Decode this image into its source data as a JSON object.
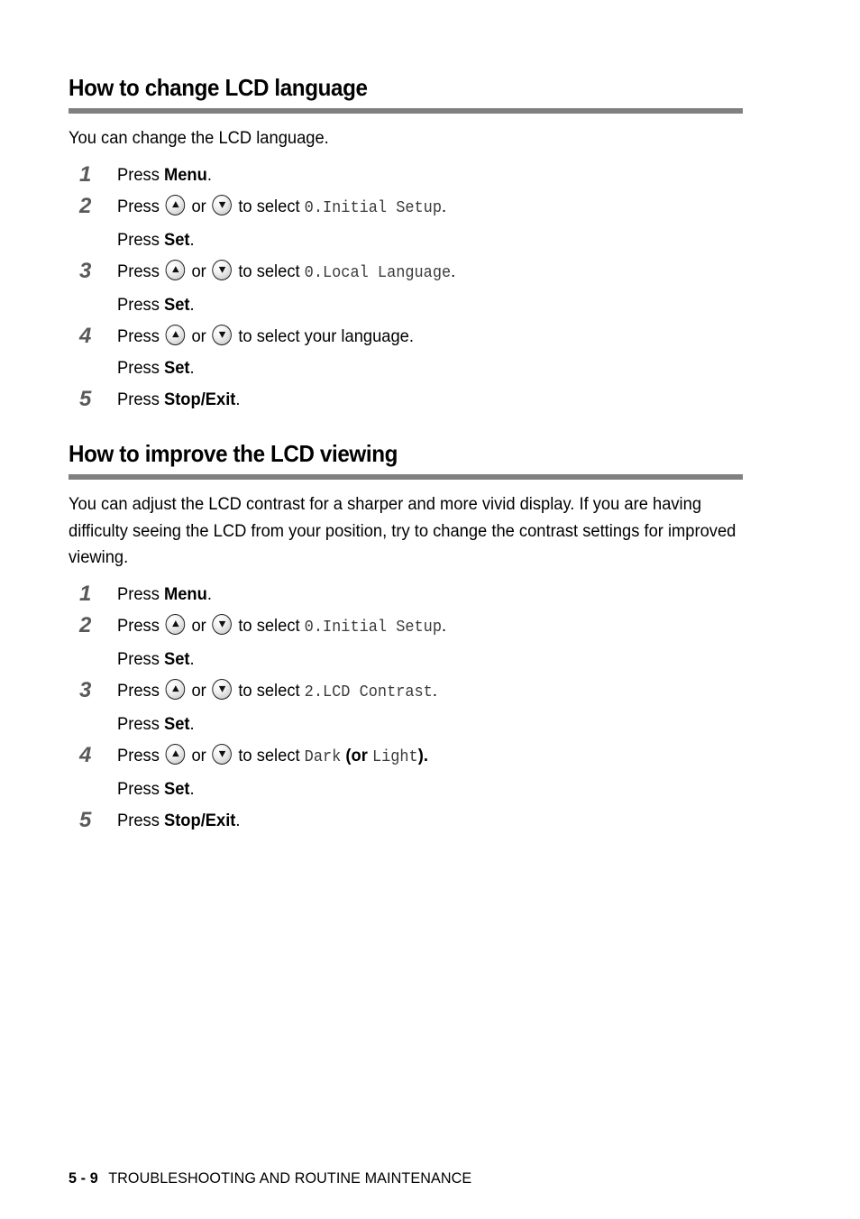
{
  "page": {
    "footer_page_number": "5 - 9",
    "footer_title": "TROUBLESHOOTING AND ROUTINE MAINTENANCE",
    "rule_color": "#808080",
    "step_number_color": "#58595b",
    "lcd_text_color": "#3b3b3b"
  },
  "sections": [
    {
      "heading": "How to change LCD language",
      "intro": "You can change the LCD language.",
      "steps": {
        "n1": "1",
        "n2": "2",
        "n3": "3",
        "n4": "4",
        "n5": "5",
        "s1_press": "Press",
        "s1_key": "Menu",
        "s1_period": ".",
        "s2_press": "Press",
        "s2_or": "or",
        "s2_select": "to select",
        "s2_lcd": "0.Initial Setup",
        "s2_period": ".",
        "s2_sub_press": "Press",
        "s2_sub_key": "Set",
        "s2_sub_period": ".",
        "s3_press": "Press",
        "s3_or": "or",
        "s3_select": "to select",
        "s3_lcd": "0.Local Language",
        "s3_period": ".",
        "s3_sub_press": "Press",
        "s3_sub_key": "Set",
        "s3_sub_period": ".",
        "s4_press": "Press",
        "s4_or": "or",
        "s4_select": "to select your language.",
        "s4_sub_press": "Press",
        "s4_sub_key": "Set",
        "s4_sub_period": ".",
        "s5_press": "Press",
        "s5_key": "Stop/Exit",
        "s5_period": "."
      }
    },
    {
      "heading": "How to improve the LCD viewing",
      "intro": "You can adjust the LCD contrast for a sharper and more vivid display. If you are having difficulty seeing the LCD from your position, try to change the contrast settings for improved viewing.",
      "steps": {
        "n1": "1",
        "n2": "2",
        "n3": "3",
        "n4": "4",
        "n5": "5",
        "s1_press": "Press",
        "s1_key": "Menu",
        "s1_period": ".",
        "s2_press": "Press",
        "s2_or": "or",
        "s2_select": "to select",
        "s2_lcd": "0.Initial Setup",
        "s2_period": ".",
        "s2_sub_press": "Press",
        "s2_sub_key": "Set",
        "s2_sub_period": ".",
        "s3_press": "Press",
        "s3_or": "or",
        "s3_select": "to select",
        "s3_lcd": "2.LCD Contrast",
        "s3_period": ".",
        "s3_sub_press": "Press",
        "s3_sub_key": "Set",
        "s3_sub_period": ".",
        "s4_press": "Press",
        "s4_or": "or",
        "s4_select": "to select",
        "s4_lcd_dark": "Dark",
        "s4_or_open": "(or",
        "s4_lcd_light": "Light",
        "s4_close": ").",
        "s4_sub_press": "Press",
        "s4_sub_key": "Set",
        "s4_sub_period": ".",
        "s5_press": "Press",
        "s5_key": "Stop/Exit",
        "s5_period": "."
      }
    }
  ],
  "icons": {
    "up_arrow": "arrow-up-key-icon",
    "down_arrow": "arrow-down-key-icon"
  }
}
